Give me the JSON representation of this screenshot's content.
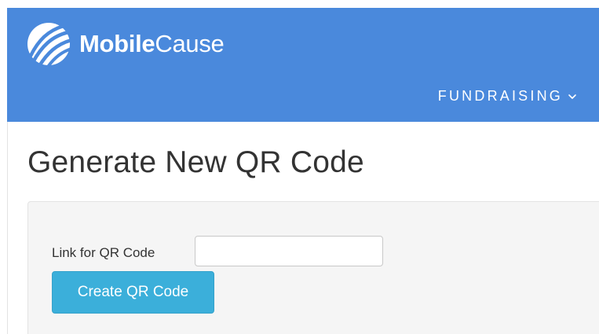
{
  "header": {
    "brand_bold": "Mobile",
    "brand_light": "Cause",
    "logo_icon": "mobilecause-logo-icon",
    "nav": {
      "fundraising_label": "FUNDRAISING",
      "dropdown_icon": "chevron-down-icon"
    },
    "color": "#4a89dc"
  },
  "main": {
    "title": "Generate New QR Code",
    "form": {
      "link_label": "Link for QR Code",
      "link_value": "",
      "link_placeholder": "",
      "create_button_label": "Create QR Code",
      "button_color": "#3bafda"
    }
  }
}
